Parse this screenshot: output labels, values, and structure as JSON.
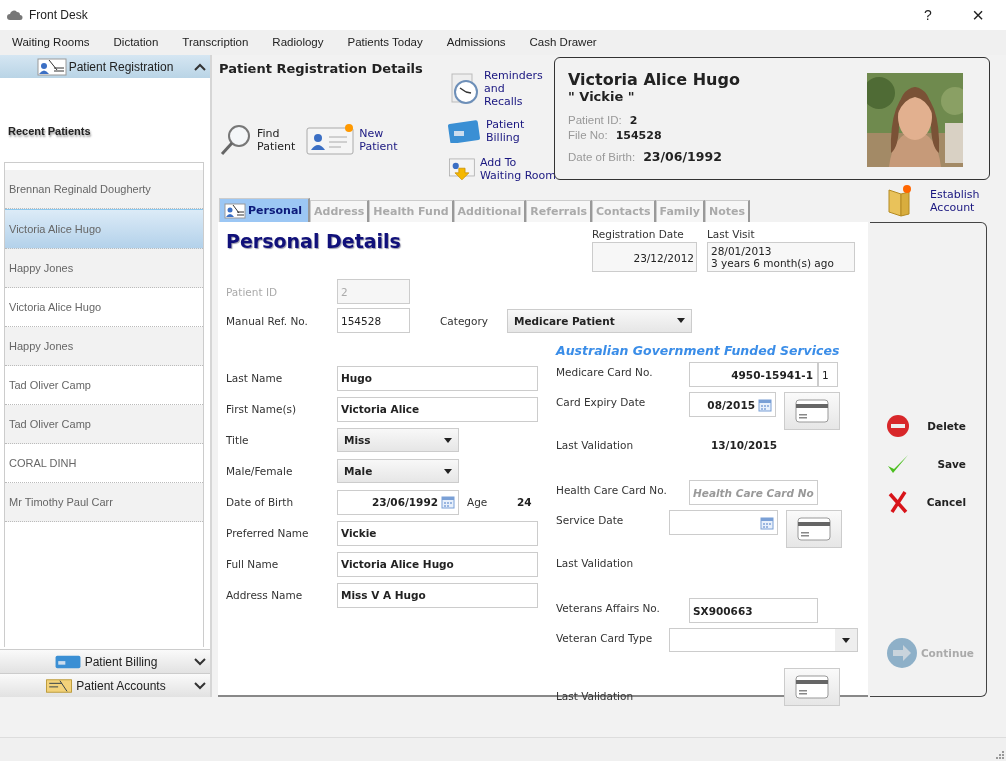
{
  "window": {
    "title": "Front Desk",
    "help": "?",
    "close": "×"
  },
  "menu": [
    "Waiting Rooms",
    "Dictation",
    "Transcription",
    "Radiology",
    "Patients Today",
    "Admissions",
    "Cash Drawer"
  ],
  "sidebar": {
    "top_section": {
      "label": "Patient Registration",
      "expanded": true
    },
    "recent_title": "Recent Patients",
    "recent_patients": [
      {
        "name": "Brennan Reginald Dougherty",
        "selected": false
      },
      {
        "name": "Victoria Alice Hugo",
        "selected": true
      },
      {
        "name": "Happy Jones",
        "selected": false
      },
      {
        "name": "Victoria Alice Hugo",
        "selected": false
      },
      {
        "name": "Happy Jones",
        "selected": false
      },
      {
        "name": "Tad Oliver Camp",
        "selected": false
      },
      {
        "name": "Tad Oliver Camp",
        "selected": false
      },
      {
        "name": "CORAL DINH",
        "selected": false
      },
      {
        "name": "Mr Timothy Paul Carr",
        "selected": false
      }
    ],
    "bottom_sections": [
      {
        "label": "Patient Billing",
        "kind": "billing",
        "expanded": false
      },
      {
        "label": "Patient Accounts",
        "kind": "accounts",
        "expanded": false
      }
    ]
  },
  "header": {
    "title": "Patient Registration Details",
    "left_actions": [
      {
        "kind": "find",
        "lines": [
          "Find",
          "Patient"
        ]
      },
      {
        "kind": "new",
        "lines": [
          "New",
          "Patient"
        ]
      }
    ],
    "column_actions": [
      {
        "kind": "reminders",
        "lines": [
          "Reminders",
          "and",
          "Recalls"
        ]
      },
      {
        "kind": "billing",
        "lines": [
          "Patient",
          "Billing"
        ]
      },
      {
        "kind": "waiting",
        "lines": [
          "Add To",
          "Waiting Room"
        ]
      }
    ]
  },
  "patient_card": {
    "name": "Victoria Alice Hugo",
    "nickname": "\" Vickie \"",
    "fields": [
      {
        "label": "Patient ID:",
        "value": "2"
      },
      {
        "label": "File No:",
        "value": "154528"
      },
      {
        "label": "Date of Birth:",
        "value": "23/06/1992"
      }
    ]
  },
  "establish_account": {
    "lines": [
      "Establish",
      "Account"
    ]
  },
  "tabs": [
    {
      "label": "Personal",
      "selected": true
    },
    {
      "label": "Address",
      "selected": false
    },
    {
      "label": "Health Fund",
      "selected": false
    },
    {
      "label": "Additional",
      "selected": false
    },
    {
      "label": "Referrals",
      "selected": false
    },
    {
      "label": "Contacts",
      "selected": false
    },
    {
      "label": "Family",
      "selected": false
    },
    {
      "label": "Notes",
      "selected": false
    }
  ],
  "form": {
    "heading": "Personal Details",
    "registration_date": {
      "label": "Registration Date",
      "value": "23/12/2012"
    },
    "last_visit": {
      "label": "Last Visit",
      "lines": [
        "28/01/2013",
        "3 years 6 month(s) ago"
      ]
    },
    "id_fields": [
      {
        "label": "Patient ID",
        "value": "2",
        "disabled": true
      },
      {
        "label": "Manual Ref. No.",
        "value": "154528",
        "disabled": false
      }
    ],
    "category": {
      "label": "Category",
      "value": "Medicare Patient"
    },
    "person_fields": [
      {
        "kind": "text",
        "label": "Last Name",
        "value": "Hugo"
      },
      {
        "kind": "text",
        "label": "First Name(s)",
        "value": "Victoria Alice"
      },
      {
        "kind": "select",
        "label": "Title",
        "value": "Miss"
      },
      {
        "kind": "select",
        "label": "Male/Female",
        "value": "Male"
      },
      {
        "kind": "date",
        "label": "Date of Birth",
        "value": "23/06/1992"
      },
      {
        "kind": "text",
        "label": "Preferred Name",
        "value": "Vickie"
      },
      {
        "kind": "text",
        "label": "Full Name",
        "value": "Victoria Alice Hugo"
      },
      {
        "kind": "text",
        "label": "Address Name",
        "value": "Miss V A Hugo"
      }
    ],
    "age": {
      "label": "Age",
      "value": "24"
    },
    "government": {
      "title": "Australian Government Funded Services",
      "groups": [
        [
          {
            "kind": "medicare",
            "label": "Medicare Card No.",
            "value": "4950-15941-1",
            "issue": "1"
          },
          {
            "kind": "date_swipe",
            "label": "Card Expiry Date",
            "value": "08/2015"
          },
          {
            "kind": "validation",
            "label": "Last Validation",
            "value": "13/10/2015"
          }
        ],
        [
          {
            "kind": "text",
            "label": "Health Care Card No.",
            "placeholder": "Health Care Card No"
          },
          {
            "kind": "date_swipe",
            "label": "Service Date"
          },
          {
            "kind": "validation",
            "label": "Last Validation"
          }
        ],
        [
          {
            "kind": "text",
            "label": "Veterans Affairs No.",
            "value": "SX900663"
          },
          {
            "kind": "select",
            "label": "Veteran Card Type"
          },
          {
            "kind": "validation_swipe",
            "label": "Last Validation"
          }
        ]
      ]
    }
  },
  "actions": [
    {
      "kind": "delete",
      "label": "Delete",
      "disabled": false
    },
    {
      "kind": "save",
      "label": "Save",
      "disabled": false
    },
    {
      "kind": "cancel",
      "label": "Cancel",
      "disabled": false
    },
    {
      "kind": "continue",
      "label": "Continue",
      "disabled": true
    }
  ]
}
